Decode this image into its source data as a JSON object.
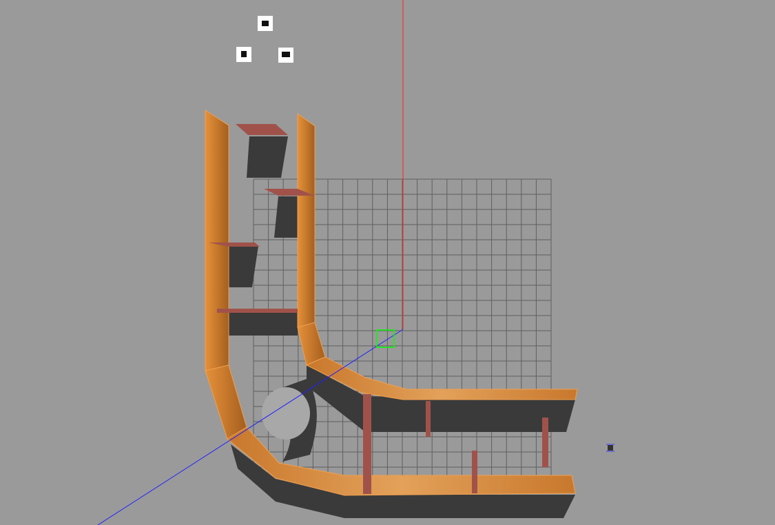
{
  "scene": {
    "background_color": "#9a9a9a",
    "grid_color": "#5f5f5f",
    "wood_color": "#c97a2b",
    "shadow_color": "#3a3a3a",
    "shelf_color": "#a0524a",
    "z_axis_color": "#ff2020",
    "x_axis_color": "#2020ff",
    "origin_marker_color": "#00ff00"
  },
  "overlay_icons": [
    "camera-icon",
    "light-icon",
    "camera-icon"
  ],
  "model_icon": "robot-model-icon"
}
